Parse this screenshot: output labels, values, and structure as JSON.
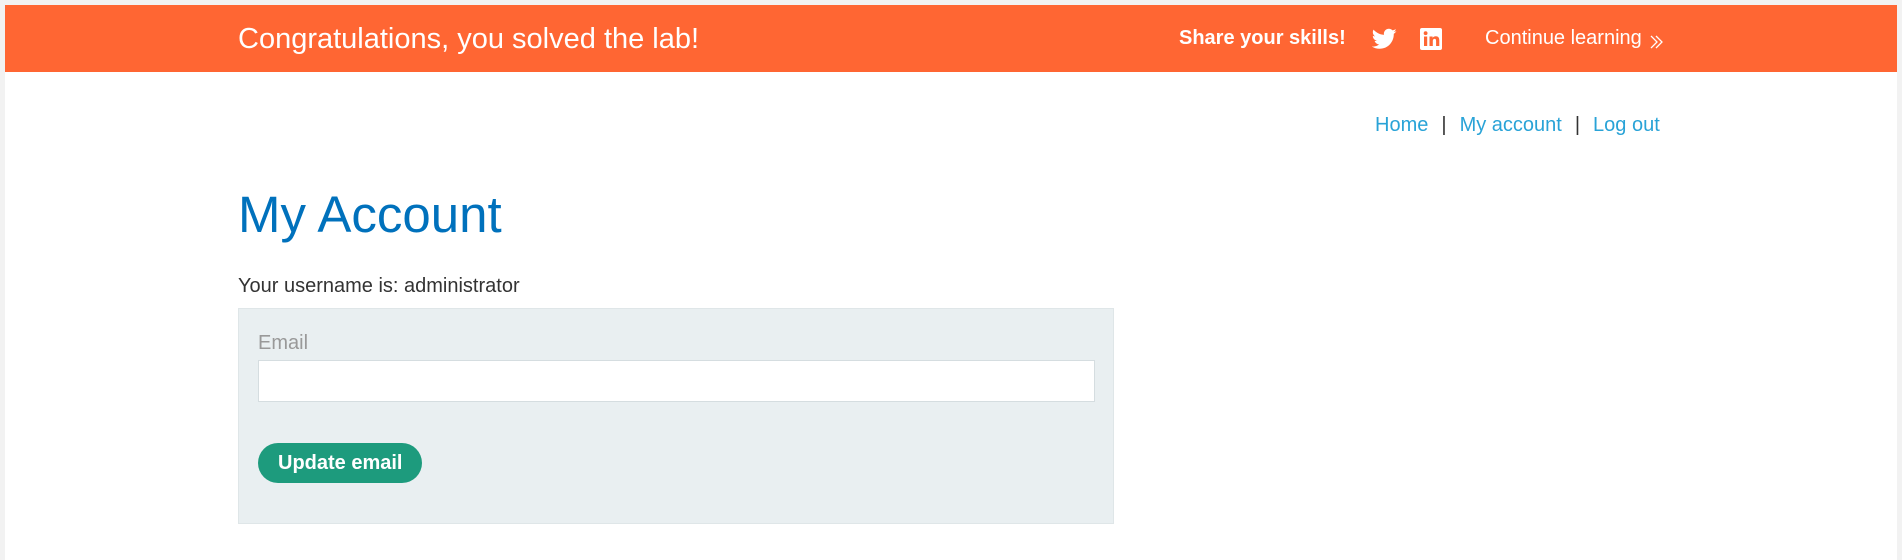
{
  "banner": {
    "title": "Congratulations, you solved the lab!",
    "share_label": "Share your skills!",
    "twitter_icon": "twitter-icon",
    "linkedin_icon": "linkedin-icon",
    "continue_label": "Continue learning",
    "continue_icon": "double-chevron-right-icon",
    "background_color": "#ff6633"
  },
  "nav": {
    "items": [
      {
        "label": "Home"
      },
      {
        "label": "My account"
      },
      {
        "label": "Log out"
      }
    ],
    "separator": "|",
    "link_color": "#29a3d7"
  },
  "main": {
    "title": "My Account",
    "title_color": "#0071bc",
    "username_text": "Your username is: administrator",
    "form": {
      "email_label": "Email",
      "email_value": "",
      "submit_label": "Update email",
      "button_color": "#1d9b7d",
      "panel_color": "#e9eff1"
    }
  }
}
